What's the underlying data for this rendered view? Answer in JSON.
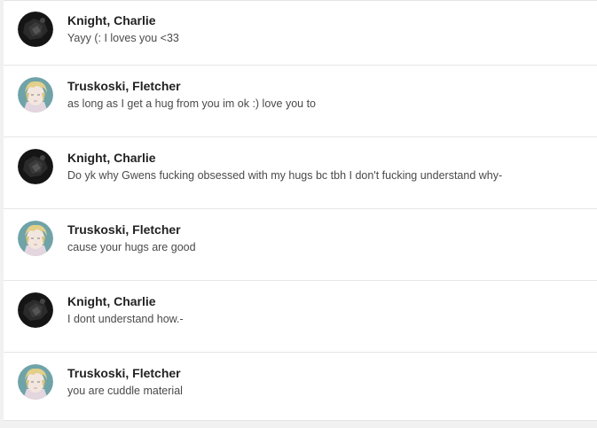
{
  "messages": [
    {
      "author": "Knight, Charlie",
      "text": "Yayy (: I loves you <33",
      "avatar": "dark-avatar"
    },
    {
      "author": "Truskoski, Fletcher",
      "text": "as long as I get a hug from you im ok :) love you to",
      "avatar": "blond-avatar"
    },
    {
      "author": "Knight, Charlie",
      "text": "Do yk why Gwens fucking obsessed with my hugs bc tbh I don't fucking understand why-",
      "avatar": "dark-avatar"
    },
    {
      "author": "Truskoski, Fletcher",
      "text": "cause your hugs are good",
      "avatar": "blond-avatar"
    },
    {
      "author": "Knight, Charlie",
      "text": "I dont understand how.-",
      "avatar": "dark-avatar"
    },
    {
      "author": "Truskoski, Fletcher",
      "text": "you are cuddle material",
      "avatar": "blond-avatar"
    }
  ]
}
